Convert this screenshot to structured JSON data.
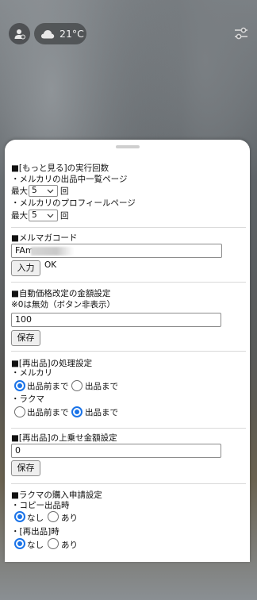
{
  "topbar": {
    "account_icon": "account-icon",
    "weather_icon": "cloud-icon",
    "temperature": "21°C",
    "settings_icon": "sliders-icon"
  },
  "sheet": {
    "more_section": {
      "title": "■[もっと見る]の実行回数",
      "listing_label": "・メルカリの出品中一覧ページ",
      "max_label": "最大",
      "listing_value": "5",
      "unit": "回",
      "profile_label": "・メルカリのプロフィールページ",
      "profile_value": "5"
    },
    "mailmag_section": {
      "title": "■メルマガコード",
      "code_value": "FAm",
      "input_button": "入力",
      "status": "OK"
    },
    "autoprice_section": {
      "title": "■自動価格改定の金額設定",
      "note": "※0は無効（ボタン非表示）",
      "value": "100",
      "save_button": "保存"
    },
    "relist_section": {
      "title": "■[再出品]の処理設定",
      "mercari_label": "・メルカリ",
      "rakuma_label": "・ラクマ",
      "option_before": "出品前まで",
      "option_until": "出品まで",
      "mercari_selected": "出品前まで",
      "rakuma_selected": "出品まで"
    },
    "markup_section": {
      "title": "■[再出品]の上乗せ金額設定",
      "value": "0",
      "save_button": "保存"
    },
    "rakuma_section": {
      "title": "■ラクマの購入申請設定",
      "copy_label": "・コピー出品時",
      "relist_label": "・[再出品]時",
      "option_none": "なし",
      "option_yes": "あり",
      "copy_selected": "なし",
      "relist_selected": "なし"
    }
  },
  "colors": {
    "accent": "#1a73e8",
    "sheet_bg": "#ffffff"
  }
}
